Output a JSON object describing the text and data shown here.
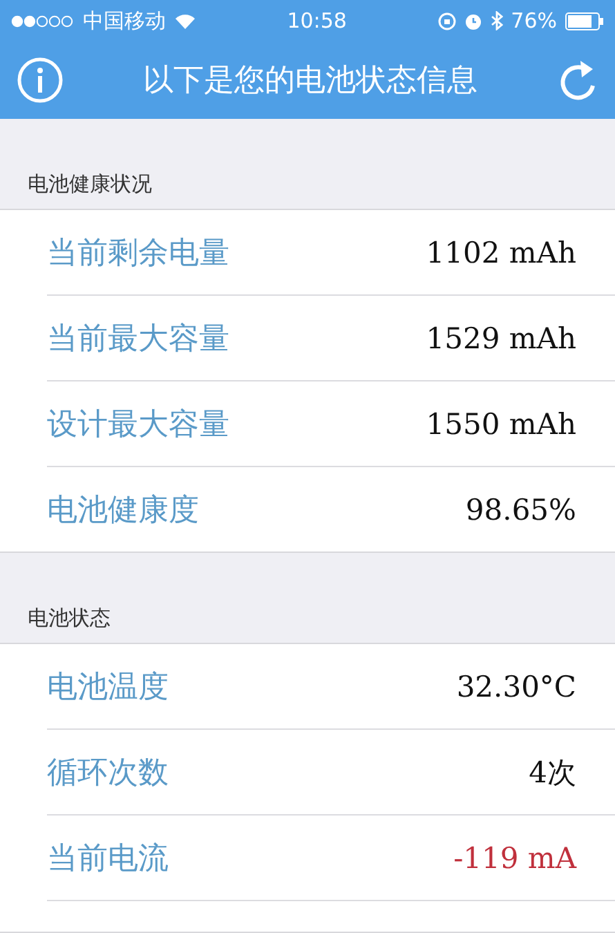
{
  "status_bar": {
    "carrier": "中国移动",
    "time": "10:58",
    "battery": "76%"
  },
  "nav_bar": {
    "title": "以下是您的电池状态信息"
  },
  "sections": [
    {
      "header": "电池健康状况",
      "rows": [
        {
          "label": "当前剩余电量",
          "value": "1102 mAh",
          "color": "#111111"
        },
        {
          "label": "当前最大容量",
          "value": "1529 mAh",
          "color": "#111111"
        },
        {
          "label": "设计最大容量",
          "value": "1550 mAh",
          "color": "#111111"
        },
        {
          "label": "电池健康度",
          "value": "98.65%",
          "color": "#111111"
        }
      ]
    },
    {
      "header": "电池状态",
      "rows": [
        {
          "label": "电池温度",
          "value": "32.30°C",
          "color": "#111111"
        },
        {
          "label": "循环次数",
          "value": "4次",
          "color": "#111111"
        },
        {
          "label": "当前电流",
          "value": "-119 mA",
          "color": "#c0303c"
        }
      ]
    }
  ]
}
